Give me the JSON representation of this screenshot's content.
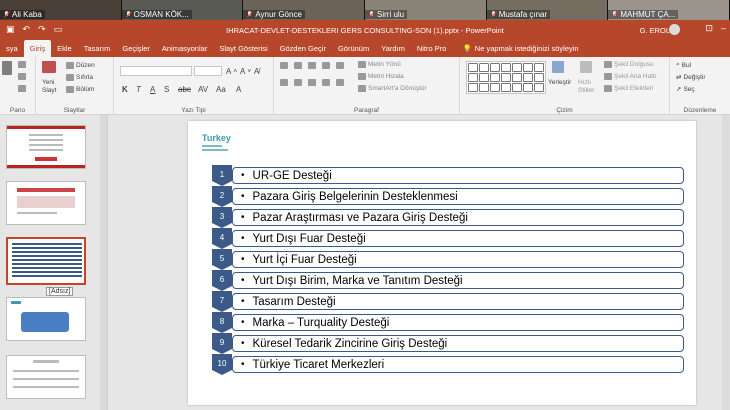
{
  "video_participants": [
    {
      "name": "Ali Kaba"
    },
    {
      "name": "OSMAN KÖK..."
    },
    {
      "name": "Aynur Gönce"
    },
    {
      "name": "Sirri ulu"
    },
    {
      "name": "Mustafa çınar"
    },
    {
      "name": "MAHMUT ÇA..."
    }
  ],
  "titlebar": {
    "title": "IHRACAT-DEVLET-DESTEKLERI GERS CONSULTING-SON (1).pptx  -  PowerPoint",
    "user": "G. EROL",
    "qa_icons": [
      "save-icon",
      "undo-icon",
      "redo-icon",
      "present-icon"
    ]
  },
  "tabs": [
    {
      "label": "sya"
    },
    {
      "label": "Giriş",
      "active": true
    },
    {
      "label": "Ekle"
    },
    {
      "label": "Tasarım"
    },
    {
      "label": "Geçişler"
    },
    {
      "label": "Animasyonlar"
    },
    {
      "label": "Slayt Gösterisi"
    },
    {
      "label": "Gözden Geçir"
    },
    {
      "label": "Görünüm"
    },
    {
      "label": "Yardım"
    },
    {
      "label": "Nitro Pro"
    }
  ],
  "tell_me": "Ne yapmak istediğinizi söyleyin",
  "ribbon": {
    "groups": {
      "clipboard": "Pano",
      "slides": "Slaytlar",
      "font": "Yazı Tipi",
      "paragraph": "Paragraf",
      "drawing": "Çizim",
      "editing": "Düzenleme"
    },
    "buttons": {
      "new_slide_line1": "Yeni",
      "new_slide_line2": "Slayt",
      "layout": "Düzen",
      "reset": "Sıfırla",
      "section": "Bölüm",
      "text_direction": "Metin Yönü",
      "align_text": "Metni Hizala",
      "smartart": "SmartArt'a Dönüştür",
      "arrange": "Yerleştir",
      "quick_styles_line1": "Hızlı",
      "quick_styles_line2": "Stiller",
      "shape_fill": "Şekil Dolgusu",
      "shape_outline": "Şekil Ana Hattı",
      "shape_effects": "Şekil Efektleri",
      "find": "Bul",
      "replace": "Değiştir",
      "select": "Seç"
    }
  },
  "thumbnail_tooltip": "[Adsız]",
  "slide": {
    "logo_brand": "Turkey",
    "items": [
      {
        "num": "1",
        "text": "UR-GE Desteği"
      },
      {
        "num": "2",
        "text": "Pazara Giriş Belgelerinin Desteklenmesi"
      },
      {
        "num": "3",
        "text": "Pazar Araştırması ve Pazara Giriş Desteği"
      },
      {
        "num": "4",
        "text": "Yurt Dışı Fuar Desteği"
      },
      {
        "num": "5",
        "text": "Yurt İçi Fuar Desteği"
      },
      {
        "num": "6",
        "text": "Yurt Dışı Birim, Marka ve Tanıtım Desteği"
      },
      {
        "num": "7",
        "text": "Tasarım Desteği"
      },
      {
        "num": "8",
        "text": "Marka – Turquality Desteği"
      },
      {
        "num": "9",
        "text": "Küresel Tedarik Zincirine Giriş Desteği"
      },
      {
        "num": "10",
        "text": "Türkiye Ticaret Merkezleri"
      }
    ],
    "accent_color": "#3b5a87"
  },
  "colors": {
    "ribbon_accent": "#b7472a"
  }
}
